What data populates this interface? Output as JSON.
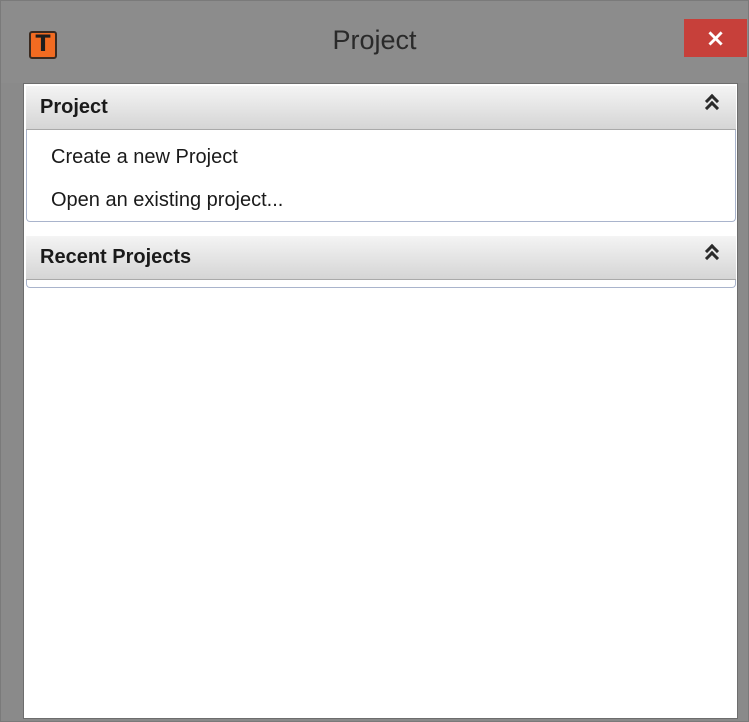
{
  "window": {
    "title": "Project",
    "close_glyph": "×",
    "app_icon_glyph": "T"
  },
  "sections": [
    {
      "title": "Project",
      "items": [
        {
          "label": "Create a new Project"
        },
        {
          "label": "Open an existing project..."
        }
      ]
    },
    {
      "title": "Recent Projects",
      "items": []
    }
  ],
  "icons": {
    "app": "app-logo-icon",
    "close": "close-icon",
    "collapse": "double-chevron-up-icon"
  },
  "colors": {
    "frame": "#8c8c8c",
    "close": "#c7403a",
    "app_icon": "#f26b21"
  }
}
